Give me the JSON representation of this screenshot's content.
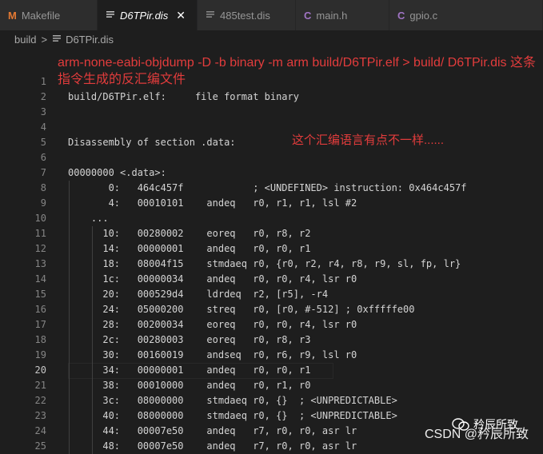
{
  "tabs": [
    {
      "icon": "M",
      "label": "Makefile"
    },
    {
      "icon": "",
      "label": "D6TPir.dis",
      "close": "✕"
    },
    {
      "icon": "≡",
      "label": "485test.dis"
    },
    {
      "icon": "C",
      "label": "main.h"
    },
    {
      "icon": "C",
      "label": "gpio.c"
    }
  ],
  "breadcrumb": {
    "folder": "build",
    "sep": ">",
    "file": "D6TPir.dis"
  },
  "annotations": {
    "command": "arm-none-eabi-objdump -D -b binary -m arm  build/D6TPir.elf > build/ D6TPir.dis   这条指令生成的反汇编文件",
    "remark": "这个汇编语言有点不一样......"
  },
  "lines": [
    {
      "n": "1",
      "text": ""
    },
    {
      "n": "2",
      "text": "build/D6TPir.elf:     file format binary"
    },
    {
      "n": "3",
      "text": ""
    },
    {
      "n": "4",
      "text": ""
    },
    {
      "n": "5",
      "text": "Disassembly of section .data:"
    },
    {
      "n": "6",
      "text": ""
    },
    {
      "n": "7",
      "text": "00000000 <.data>:"
    },
    {
      "n": "8",
      "text": "       0:   464c457f            ; <UNDEFINED> instruction: 0x464c457f"
    },
    {
      "n": "9",
      "text": "       4:   00010101    andeq   r0, r1, r1, lsl #2"
    },
    {
      "n": "10",
      "text": "    ..."
    },
    {
      "n": "11",
      "text": "      10:   00280002    eoreq   r0, r8, r2"
    },
    {
      "n": "12",
      "text": "      14:   00000001    andeq   r0, r0, r1"
    },
    {
      "n": "13",
      "text": "      18:   08004f15    stmdaeq r0, {r0, r2, r4, r8, r9, sl, fp, lr}"
    },
    {
      "n": "14",
      "text": "      1c:   00000034    andeq   r0, r0, r4, lsr r0"
    },
    {
      "n": "15",
      "text": "      20:   000529d4    ldrdeq  r2, [r5], -r4"
    },
    {
      "n": "16",
      "text": "      24:   05000200    streq   r0, [r0, #-512] ; 0xfffffe00"
    },
    {
      "n": "17",
      "text": "      28:   00200034    eoreq   r0, r0, r4, lsr r0"
    },
    {
      "n": "18",
      "text": "      2c:   00280003    eoreq   r0, r8, r3"
    },
    {
      "n": "19",
      "text": "      30:   00160019    andseq  r0, r6, r9, lsl r0"
    },
    {
      "n": "20",
      "text": "      34:   00000001    andeq   r0, r0, r1"
    },
    {
      "n": "21",
      "text": "      38:   00010000    andeq   r0, r1, r0"
    },
    {
      "n": "22",
      "text": "      3c:   08000000    stmdaeq r0, {}  ; <UNPREDICTABLE>"
    },
    {
      "n": "23",
      "text": "      40:   08000000    stmdaeq r0, {}  ; <UNPREDICTABLE>"
    },
    {
      "n": "24",
      "text": "      44:   00007e50    andeq   r7, r0, r0, asr lr"
    },
    {
      "n": "25",
      "text": "      48:   00007e50    andeq   r7, r0, r0, asr lr"
    }
  ],
  "current_line": "20",
  "watermark": {
    "account": "矜辰所致",
    "site": "CSDN @矜辰所致"
  }
}
